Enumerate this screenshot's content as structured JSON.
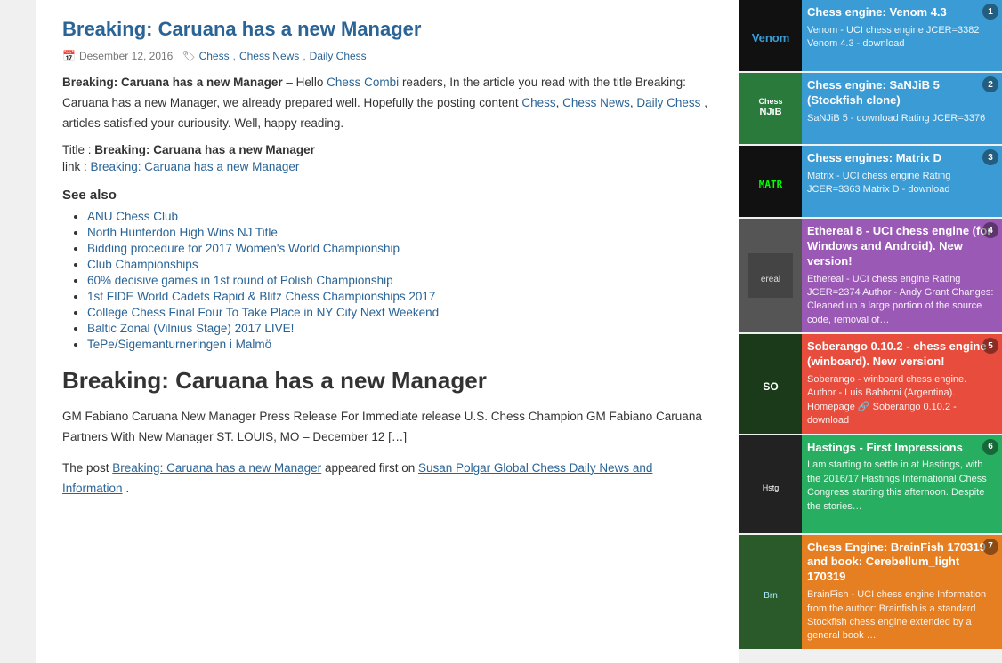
{
  "main": {
    "article1": {
      "title": "Breaking: Caruana has a new Manager",
      "date": "Desember 12, 2016",
      "tags": "Chess, Chess News, Daily Chess",
      "intro_bold": "Breaking: Caruana has a new Manager",
      "intro_text": " – Hello ",
      "intro_link_text": "Chess Combi",
      "intro_rest": " readers, In the article you read with the title Breaking: Caruana has a new Manager, we already prepared well. Hopefully the posting content ",
      "intro_links": "Chess, Chess News, Daily Chess",
      "intro_end": ", articles satisfied your curiousity. Well, happy reading.",
      "title_label": "Title :",
      "title_value": "Breaking: Caruana has a new Manager",
      "link_label": "link :",
      "link_value": "Breaking: Caruana has a new Manager",
      "see_also": "See also",
      "see_also_items": [
        "ANU Chess Club",
        "North Hunterdon High Wins NJ Title",
        "Bidding procedure for 2017 Women's World Championship",
        "Club Championships",
        "60% decisive games in 1st round of Polish Championship",
        "1st FIDE World Cadets Rapid & Blitz Chess Championships 2017",
        "College Chess Final Four To Take Place in NY City Next Weekend",
        "Baltic Zonal (Vilnius Stage) 2017 LIVE!",
        "TePe/Sigemanturneringen i Malmö"
      ]
    },
    "article2": {
      "title": "Breaking: Caruana has a new Manager",
      "body1": "GM Fabiano Caruana New Manager Press Release For Immediate release U.S. Chess Champion GM Fabiano Caruana Partners With New Manager ST. LOUIS, MO – December 12 […]",
      "body2_prefix": "The post ",
      "body2_link": "Breaking: Caruana has a new Manager",
      "body2_mid": " appeared first on ",
      "body2_link2": "Susan Polgar Global Chess Daily News and Information",
      "body2_end": "."
    }
  },
  "sidebar": {
    "items": [
      {
        "number": "1",
        "title": "Chess engine: Venom 4.3",
        "desc": "Venom  -  UCI chess engine JCER=3382 Venom 4.3 - download",
        "thumb_label": "Venom",
        "color_class": "sidebar-item-1",
        "thumb_class": "venom-thumb"
      },
      {
        "number": "2",
        "title": "Chess engine: SaNJiB 5 (Stockfish clone)",
        "desc": "SaNJiB 5 - download Rating JCER=3376",
        "thumb_label": "NJiB",
        "color_class": "sidebar-item-2",
        "thumb_class": "niji-thumb"
      },
      {
        "number": "3",
        "title": "Chess engines: Matrix D",
        "desc": "Matrix  -  UCI chess engine Rating JCER=3363 Matrix D - download",
        "thumb_label": "MATR",
        "color_class": "sidebar-item-3",
        "thumb_class": "matrix-thumb"
      },
      {
        "number": "4",
        "title": "Ethereal 8 - UCI chess engine (for Windows and Android). New version!",
        "desc": "Ethereal  -  UCI chess engine Rating JCER=2374 Author - Andy Grant Changes: Cleaned up a large portion of the source code, removal of…",
        "thumb_label": "ereal",
        "color_class": "sidebar-item-4",
        "thumb_class": "ethereal-thumb"
      },
      {
        "number": "5",
        "title": "Soberango 0.10.2 - chess engine (winboard). New version!",
        "desc": "Soberango  -  winboard chess engine. Author - Luis Babboni (Argentina). Homepage  🔗  Soberango 0.10.2 - download",
        "thumb_label": "SO",
        "color_class": "sidebar-item-5",
        "thumb_class": "soberango-thumb"
      },
      {
        "number": "6",
        "title": "Hastings - First Impressions",
        "desc": "I am starting to settle in at Hastings, with the 2016/17 Hastings International Chess Congress starting this afternoon. Despite the stories…",
        "thumb_label": "Hstg",
        "color_class": "sidebar-item-6",
        "thumb_class": "hastings-thumb"
      },
      {
        "number": "7",
        "title": "Chess Engine: BrainFish 170319 and book: Cerebellum_light 170319",
        "desc": "BrainFish - UCI chess engine Information from the author: Brainfish  is a standard  Stockfish  chess engine extended by a general book …",
        "thumb_label": "Brn",
        "color_class": "sidebar-item-7",
        "thumb_class": "brainfish-thumb"
      }
    ]
  }
}
